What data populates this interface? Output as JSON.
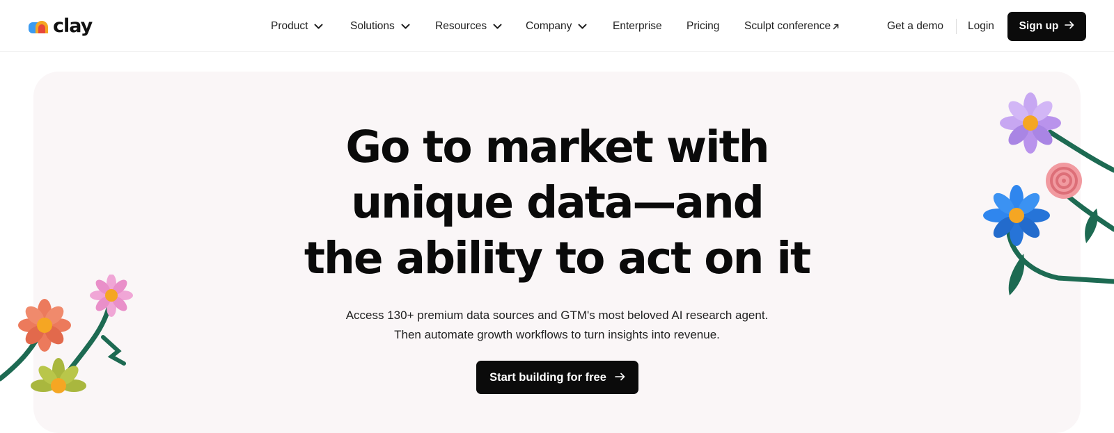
{
  "brand": {
    "name": "clay"
  },
  "nav": {
    "items": [
      {
        "label": "Product",
        "has_dropdown": true
      },
      {
        "label": "Solutions",
        "has_dropdown": true
      },
      {
        "label": "Resources",
        "has_dropdown": true
      },
      {
        "label": "Company",
        "has_dropdown": true
      },
      {
        "label": "Enterprise",
        "has_dropdown": false
      },
      {
        "label": "Pricing",
        "has_dropdown": false
      },
      {
        "label": "Sculpt conference",
        "has_dropdown": false,
        "external": true
      }
    ],
    "demo_label": "Get a demo",
    "login_label": "Login",
    "signup_label": "Sign up"
  },
  "hero": {
    "headline_lines": [
      "Go to market with",
      "unique data—and",
      "the ability to act on it"
    ],
    "sub_lines": [
      "Access 130+ premium data sources and GTM's most beloved AI research agent.",
      "Then automate growth workflows to turn insights into revenue."
    ],
    "cta_label": "Start building for free"
  },
  "icons": {
    "chevron": "chevron-down-icon",
    "external": "external-arrow-icon",
    "arrow": "arrow-right-icon",
    "logo": "clay-logo-icon",
    "decor": "flower-decoration"
  },
  "colors": {
    "button_bg": "#0b0b0b",
    "hero_bg": "#faf6f7",
    "logo_blue": "#3b9bf0",
    "logo_orange": "#f5a623",
    "logo_red": "#e8473a"
  }
}
